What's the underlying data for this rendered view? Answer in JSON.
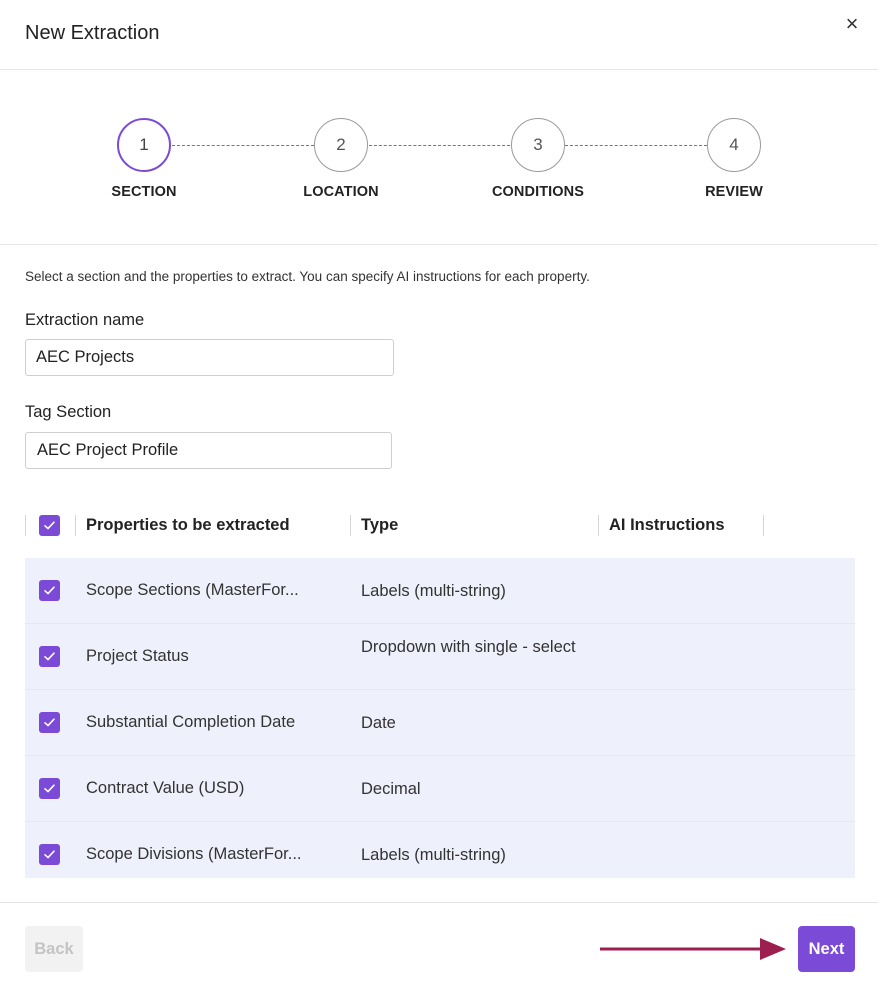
{
  "dialog": {
    "title": "New Extraction",
    "close_symbol": "×"
  },
  "stepper": {
    "steps": [
      {
        "number": "1",
        "label": "SECTION"
      },
      {
        "number": "2",
        "label": "LOCATION"
      },
      {
        "number": "3",
        "label": "CONDITIONS"
      },
      {
        "number": "4",
        "label": "REVIEW"
      }
    ],
    "active_step": 1,
    "accent_color": "#7b4ad6"
  },
  "instruction": "Select a section and the properties to extract. You can specify AI instructions for each property.",
  "extraction_name": {
    "label": "Extraction name",
    "value": "AEC Projects"
  },
  "tag_section": {
    "label": "Tag Section",
    "value": "AEC Project Profile"
  },
  "table": {
    "columns": [
      "Properties to be extracted",
      "Type",
      "AI Instructions"
    ],
    "select_all_checked": true,
    "rows": [
      {
        "name": "Scope Sections (MasterFor...",
        "type": "Labels (multi-string)",
        "checked": true
      },
      {
        "name": "Project Status",
        "type": "Dropdown with single - select",
        "checked": true
      },
      {
        "name": "Substantial Completion Date",
        "type": "Date",
        "checked": true
      },
      {
        "name": "Contract Value (USD)",
        "type": "Decimal",
        "checked": true
      },
      {
        "name": "Scope Divisions (MasterFor...",
        "type": "Labels (multi-string)",
        "checked": true
      }
    ],
    "row_background": "#eef0fc"
  },
  "footer": {
    "back_label": "Back",
    "next_label": "Next",
    "arrow_color": "#9c1f4f"
  }
}
